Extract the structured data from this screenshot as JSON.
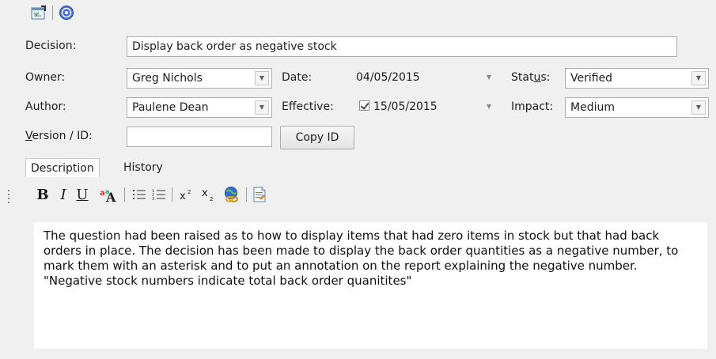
{
  "labels": {
    "decision": "Decision:",
    "owner": "Owner:",
    "author": "Author:",
    "version_prefix": "V",
    "version_rest": "ersion / ID:",
    "date": "Date:",
    "effective": "Effective:",
    "status_prefix": "Stat",
    "status_underlined": "u",
    "status_rest": "s:",
    "impact": "Impact:"
  },
  "fields": {
    "decision": "Display back order as negative stock",
    "owner": "Greg Nichols",
    "author": "Paulene Dean",
    "version_id": "",
    "date": "04/05/2015",
    "effective_checked": true,
    "effective": "15/05/2015",
    "status": "Verified",
    "impact": "Medium"
  },
  "buttons": {
    "copy_id": "Copy ID"
  },
  "tabs": [
    {
      "label": "Description",
      "active": true
    },
    {
      "label": "History",
      "active": false
    }
  ],
  "format_toolbar": {
    "bold": "B",
    "italic": "I",
    "underline": "U"
  },
  "description_text": "The question had been raised as to how to display items that had zero items in stock but that had back orders in place. The decision has been made to display the back order quantities as a negative number, to mark them with an asterisk and to put an annotation on the report explaining the negative number. \"Negative stock numbers indicate total back order quanitites\"",
  "icons": [
    "properties-icon",
    "help-icon",
    "font-color-icon",
    "bullet-list-icon",
    "numbered-list-icon",
    "superscript-icon",
    "subscript-icon",
    "hyperlink-icon",
    "document-icon"
  ],
  "colors": {
    "background": "#f0f0f0",
    "field_border": "#abadb3",
    "help_icon": "#3a5fc8"
  }
}
